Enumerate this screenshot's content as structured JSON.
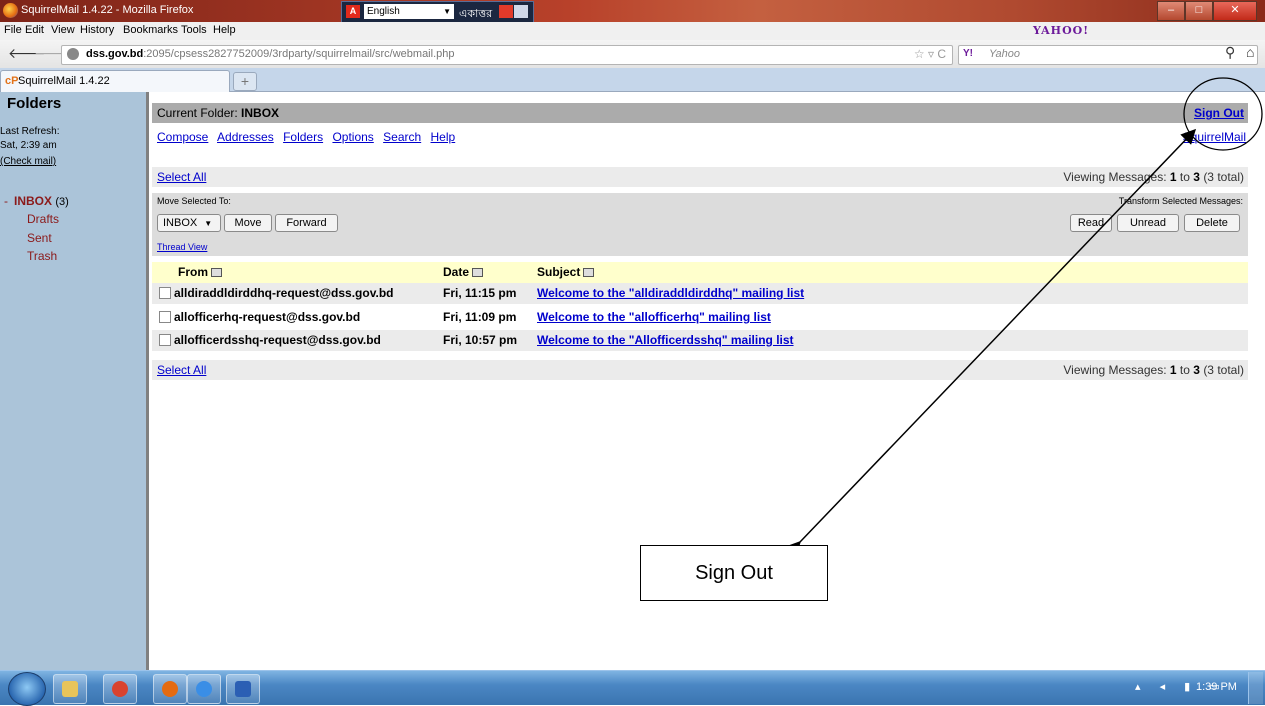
{
  "window": {
    "title": "SquirrelMail 1.4.22 - Mozilla Firefox",
    "lang_select": "English",
    "lang_label_bn": "একাত্তর"
  },
  "menu": [
    "File",
    "Edit",
    "View",
    "History",
    "Bookmarks",
    "Tools",
    "Help"
  ],
  "brand": {
    "yahoo_logo": "YAHOO!"
  },
  "url": {
    "host": "dss.gov.bd",
    "path": ":2095/cpsess2827752009/3rdparty/squirrelmail/src/webmail.php"
  },
  "search": {
    "engine_icon": "Y!",
    "placeholder": "Yahoo"
  },
  "tab": {
    "label": "SquirrelMail 1.4.22",
    "favicon": "cP"
  },
  "sidebar": {
    "heading": "Folders",
    "last_refresh_label": "Last Refresh:",
    "last_refresh_time": "Sat, 2:39 am",
    "check_mail": "(Check mail)",
    "inbox_prefix": "-",
    "inbox": "INBOX",
    "inbox_count": "(3)",
    "folders": [
      "Drafts",
      "Sent",
      "Trash"
    ]
  },
  "header": {
    "current_folder_label": "Current Folder:",
    "current_folder": "INBOX",
    "sign_out": "Sign Out",
    "squirrelmail_link": "SquirrelMail"
  },
  "nav_links": [
    "Compose",
    "Addresses",
    "Folders",
    "Options",
    "Search",
    "Help"
  ],
  "list": {
    "select_all": "Select All",
    "viewing_prefix": "Viewing Messages:",
    "viewing_from": "1",
    "viewing_to_word": "to",
    "viewing_to": "3",
    "viewing_total": "(3 total)",
    "move_selected_label": "Move Selected To:",
    "transform_label": "Transform Selected Messages:",
    "move_target": "INBOX",
    "move_button": "Move",
    "forward_button": "Forward",
    "thread_view": "Thread View",
    "read_button": "Read",
    "unread_button": "Unread",
    "delete_button": "Delete",
    "columns": {
      "from": "From",
      "date": "Date",
      "subject": "Subject"
    },
    "messages": [
      {
        "from": "alldiraddldirddhq-request@dss.gov.bd",
        "date": "Fri, 11:15 pm",
        "subject": "Welcome to the \"alldiraddldirddhq\" mailing list"
      },
      {
        "from": "allofficerhq-request@dss.gov.bd",
        "date": "Fri, 11:09 pm",
        "subject": "Welcome to the \"allofficerhq\" mailing list"
      },
      {
        "from": "allofficerdsshq-request@dss.gov.bd",
        "date": "Fri, 10:57 pm",
        "subject": "Welcome to the \"Allofficerdsshq\" mailing list"
      }
    ]
  },
  "annotation": {
    "label": "Sign Out"
  },
  "taskbar": {
    "clock": "1:39 PM"
  }
}
